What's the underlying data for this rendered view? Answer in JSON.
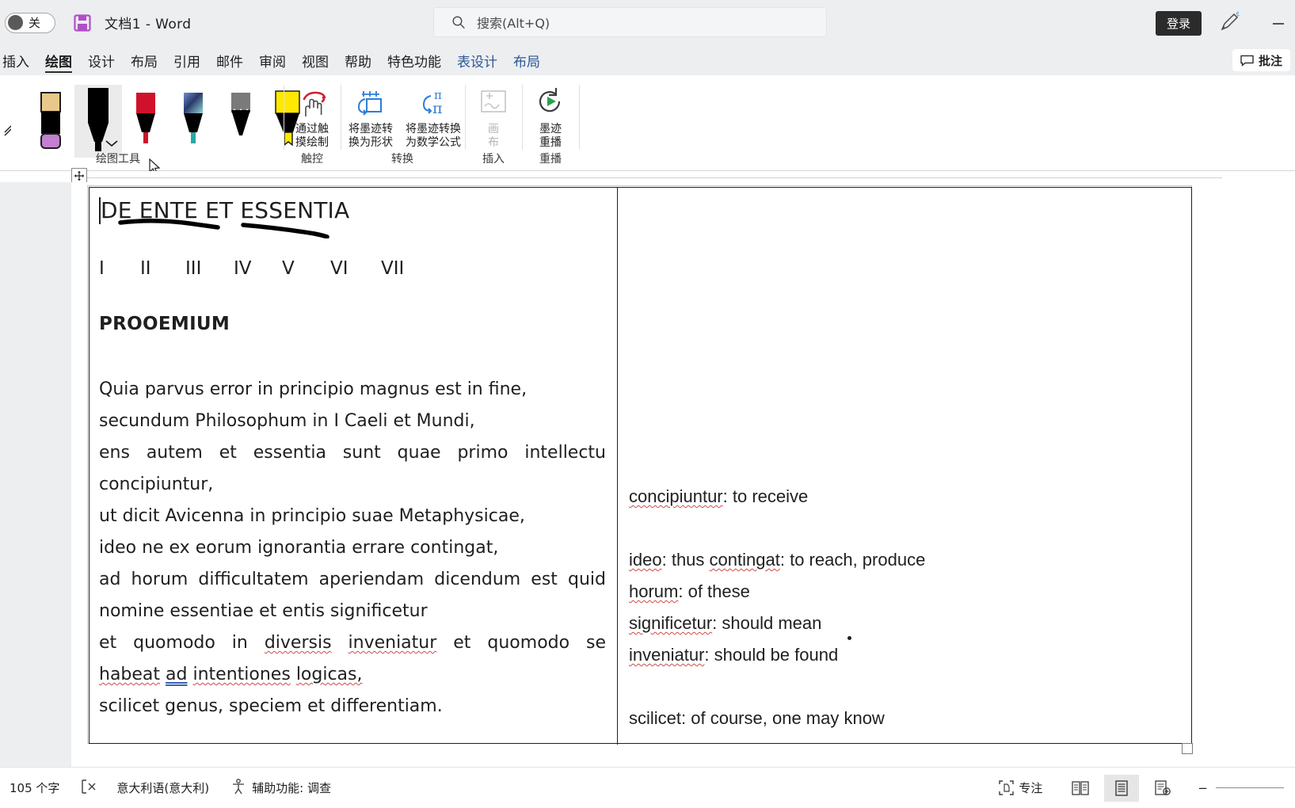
{
  "titlebar": {
    "autosave_label": "关",
    "autosave_icon": "toggle-off-icon",
    "save_icon": "save-icon",
    "document_title": "文档1  -  Word",
    "search_placeholder": "搜索(Alt+Q)",
    "search_icon": "search-icon",
    "signin_label": "登录",
    "pen_icon": "pen-highlight-icon",
    "minimize_icon": "minimize-icon"
  },
  "tabs": {
    "items": [
      {
        "label": "插入",
        "state": "normal"
      },
      {
        "label": "绘图",
        "state": "active"
      },
      {
        "label": "设计",
        "state": "normal"
      },
      {
        "label": "布局",
        "state": "normal"
      },
      {
        "label": "引用",
        "state": "normal"
      },
      {
        "label": "邮件",
        "state": "normal"
      },
      {
        "label": "审阅",
        "state": "normal"
      },
      {
        "label": "视图",
        "state": "normal"
      },
      {
        "label": "帮助",
        "state": "normal"
      },
      {
        "label": "特色功能",
        "state": "normal"
      },
      {
        "label": "表设计",
        "state": "context"
      },
      {
        "label": "布局",
        "state": "context"
      }
    ],
    "comments_label": "批注",
    "comments_icon": "comment-icon"
  },
  "ribbon": {
    "groups": [
      {
        "name": "drawing-tools",
        "label": "绘图工具"
      },
      {
        "name": "touch",
        "label": "触控"
      },
      {
        "name": "convert",
        "label": "转换"
      },
      {
        "name": "insert",
        "label": "插入"
      },
      {
        "name": "replay",
        "label": "重播"
      }
    ],
    "pens": [
      {
        "name": "eraser",
        "barrel": "#000000",
        "cap": "#e8c98a",
        "tip": "#c47fd0",
        "selected": false
      },
      {
        "name": "pen-black",
        "barrel": "#000000",
        "cap": "#000000",
        "tip": "#000000",
        "selected": true
      },
      {
        "name": "pen-red",
        "barrel": "#000000",
        "cap": "#d0112b",
        "tip": "#d0112b",
        "selected": false
      },
      {
        "name": "pen-galaxy",
        "barrel": "#000000",
        "cap": "#3b5aa0",
        "tip": "#2aa6a6",
        "selected": false
      },
      {
        "name": "pencil-gray",
        "barrel": "#000000",
        "cap": "#7a7a7a",
        "tip": "#000000",
        "selected": false
      },
      {
        "name": "highlighter-yellow",
        "barrel": "#000000",
        "cap": "#ffe800",
        "tip": "#ffe800",
        "selected": false
      }
    ],
    "commands": [
      {
        "name": "draw-with-touch",
        "label_line1": "通过触",
        "label_line2": "摸绘制",
        "icon": "hand-draw-icon",
        "disabled": false
      },
      {
        "name": "ink-to-shape",
        "label_line1": "将墨迹转",
        "label_line2": "换为形状",
        "icon": "ink-to-shape-icon",
        "disabled": false
      },
      {
        "name": "ink-to-math",
        "label_line1": "将墨迹转换",
        "label_line2": "为数学公式",
        "icon": "ink-to-math-icon",
        "disabled": false
      },
      {
        "name": "drawing-canvas",
        "label_line1": "画",
        "label_line2": "布",
        "icon": "canvas-icon",
        "disabled": true
      },
      {
        "name": "ink-replay",
        "label_line1": "墨迹",
        "label_line2": "重播",
        "icon": "replay-icon",
        "disabled": false
      }
    ]
  },
  "document": {
    "title": "DE ENTE ET ESSENTIA",
    "romans": [
      "I",
      "II",
      "III",
      "IV",
      "V",
      "VI",
      "VII"
    ],
    "heading": "PROOEMIUM",
    "latin_lines": [
      {
        "text": "Quia parvus error in principio magnus est in fine,",
        "justify": false
      },
      {
        "text": "secundum Philosophum in I Caeli et Mundi,",
        "justify": false
      },
      {
        "text": "ens autem et essentia sunt quae primo intellectu",
        "justify": true
      },
      {
        "text": "concipiuntur,",
        "justify": false
      },
      {
        "text": "ut dicit Avicenna in principio suae Metaphysicae,",
        "justify": false
      },
      {
        "text": "ideo ne ex eorum ignorantia errare contingat,",
        "justify": false
      },
      {
        "text": "ad horum difficultatem aperiendam dicendum est quid",
        "justify": true
      },
      {
        "text": "nomine essentiae et entis significetur",
        "justify": false
      },
      {
        "text": "et quomodo in diversis inveniatur et quomodo se",
        "justify": true
      },
      {
        "text": "habeat ad intentiones logicas,",
        "justify": false
      },
      {
        "text": "scilicet genus, speciem et differentiam.",
        "justify": false
      }
    ],
    "glossary": [
      {
        "term": "concipiuntur",
        "sep": ": ",
        "definition": "to receive"
      },
      {
        "term": "ideo",
        "sep": ": ",
        "definition": "thus",
        "term2": "contingat",
        "sep2": ": ",
        "definition2": "to reach, produce"
      },
      {
        "term": "horum",
        "sep": ": ",
        "definition": "of these"
      },
      {
        "term": "significetur",
        "sep": ": ",
        "definition": "should mean"
      },
      {
        "term": "inveniatur",
        "sep": ": ",
        "definition": "should be found"
      },
      {
        "term": "scilicet",
        "sep": ": ",
        "definition": "of course, one may know"
      }
    ]
  },
  "status": {
    "word_count": "105 个字",
    "proofing_icon": "proofing-icon",
    "language": "意大利语(意大利)",
    "accessibility_icon": "accessibility-icon",
    "accessibility": "辅助功能: 调查",
    "focus_icon": "focus-icon",
    "focus_label": "专注",
    "view_read_icon": "read-mode-icon",
    "view_print_icon": "print-layout-icon",
    "view_web_icon": "web-layout-icon",
    "zoom_minus": "−",
    "zoom_plus": "+"
  },
  "colors": {
    "chrome": "#eceef0",
    "accent": "#2b5797",
    "spell_error": "#d04a4a",
    "grammar_error": "#3b63b5"
  }
}
